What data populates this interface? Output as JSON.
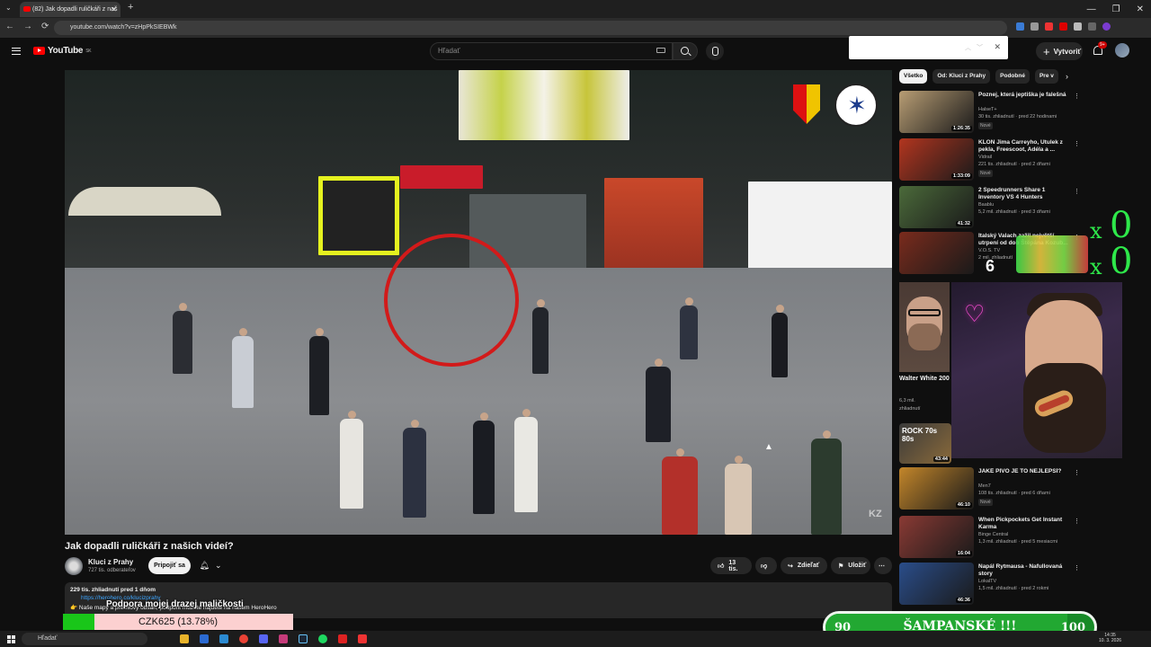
{
  "browser": {
    "tab_title": "(82) Jak dopadli ruličkáři z naš",
    "url": "youtube.com/watch?v=zHpPkSIEBWk"
  },
  "header": {
    "logo_text": "YouTube",
    "logo_region": "SK",
    "search_placeholder": "Hľadať",
    "create_label": "Vytvoriť",
    "notif_count": "9+"
  },
  "video": {
    "title": "Jak dopadli ruličkáři z našich videí?",
    "watermark": "KZ",
    "channel_name": "Kluci z Prahy",
    "subscribers": "727 tis. odberateľov",
    "subscribe_label": "Pripojiť sa",
    "like_count": "13 tis.",
    "share_label": "Zdieľať",
    "save_label": "Uložiť",
    "desc_meta": "229 tis. zhliadnutí  pred 1 dňom",
    "desc_link": "https://herohero.co/klucizprahy",
    "desc_line2": "👉 Naše mapy a prémiový obsah, podpořit můžete najdete na našem HeroHero"
  },
  "overlays": {
    "support_text": "Podpora mojej drazej maličkosti",
    "czk_label": "CZK625 (13.78%)",
    "czk_percent": 13.78,
    "shampanske_left": "90",
    "shampanske_label": "ŠAMPANSKÉ !!!",
    "shampanske_right": "100",
    "shampanske_fraction": 0.9,
    "counter_x1": "x",
    "counter_v1": "0",
    "counter_x2": "x",
    "counter_v2": "0",
    "counter_six": "6"
  },
  "sidebar": {
    "chips": [
      "Všetko",
      "Od: Kluci z Prahy",
      "Podobné",
      "Pre v"
    ],
    "recs": [
      {
        "title": "Poznej, která jeptiška je falešná",
        "channel": "HalseT+",
        "stats": "30 tis. zhliadnutí · pred 22 hodinami",
        "badge": "Nové",
        "duration": "1:26:35",
        "color": "#b89d74"
      },
      {
        "title": "KLON Jima Carreyho, Útulek z pekla, Freescoot, Adéla a ...",
        "channel": "Vidrail",
        "stats": "221 tis. zhliadnutí · pred 2 dňami",
        "badge": "Nové",
        "duration": "1:33:09",
        "color": "#b2351f"
      },
      {
        "title": "2 Speedrunners Share 1 Inventory VS 4 Hunters",
        "channel": "Baablu",
        "stats": "5,2 mil. zhliadnutí · pred 3 dňami",
        "badge": "",
        "duration": "41:32",
        "color": "#4b6a3a"
      },
      {
        "title": "Italský Valach zažil největší utrpení od dob Štěpána Kozub...",
        "channel": "V.O.S. TV",
        "stats": "2 mil. zhliadnutí",
        "badge": "",
        "duration": "",
        "color": "#7a2b1c"
      },
      {
        "title": "JAKÉ PIVO JE TO NEJLEPŠÍ?",
        "channel": "Men7",
        "stats": "108 tis. zhliadnutí · pred 6 dňami",
        "badge": "Nové",
        "duration": "46:10",
        "color": "#c3862a"
      },
      {
        "title": "When Pickpockets Get Instant Karma",
        "channel": "Binge Central",
        "stats": "1,3 mil. zhliadnutí · pred 5 mesiacmi",
        "badge": "",
        "duration": "16:04",
        "color": "#8a3a34"
      },
      {
        "title": "Napál Rytmausa - Nafullovaná story",
        "channel": "LokalTV",
        "stats": "1,5 mil. zhliadnutí · pred 2 rokmi",
        "badge": "",
        "duration": "46:36",
        "color": "#2a4d8a"
      }
    ],
    "ww_title": "Walter White 200 IQ 😳 | ...",
    "ww_meta1": "6,3 mil.",
    "ww_meta2": "zhliadnutí",
    "rock_duration": "43:44",
    "rock_text": "ROCK 70s 80s"
  },
  "taskbar": {
    "search": "Hľadať",
    "time": "14:35",
    "date": "10. 3. 2026"
  }
}
